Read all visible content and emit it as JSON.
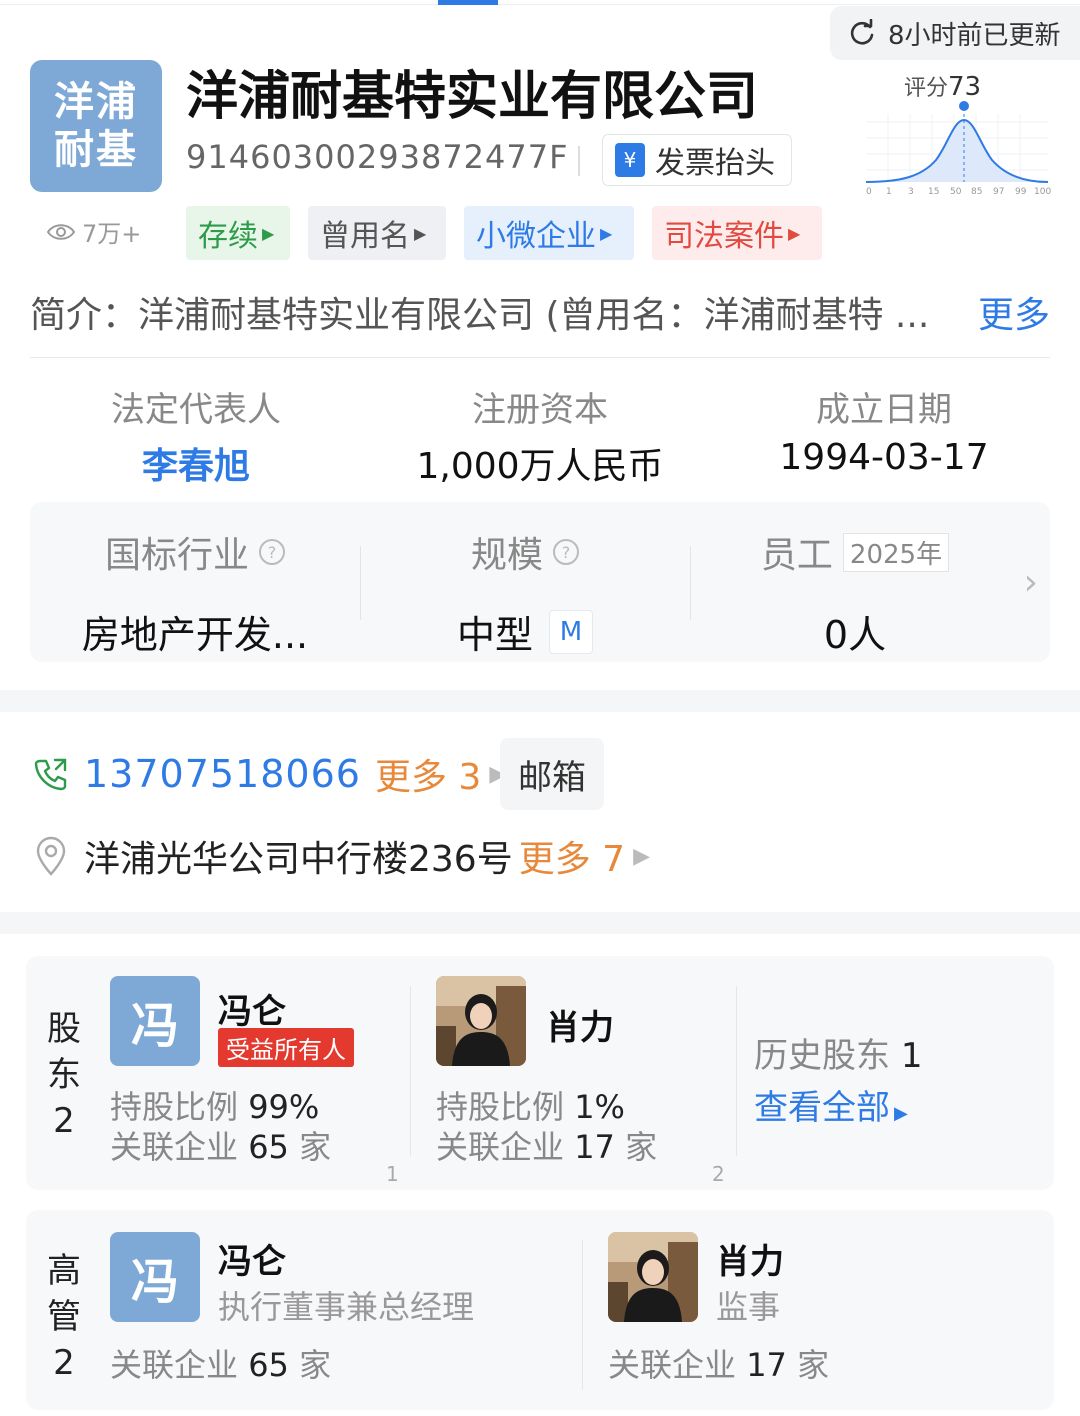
{
  "header": {
    "update_text": "8小时前已更新"
  },
  "company": {
    "logo_line1": "洋浦",
    "logo_line2": "耐基",
    "name": "洋浦耐基特实业有限公司",
    "credit_code": "9146030029387247​7F",
    "invoice_label": "发票抬头",
    "invoice_icon": "¥",
    "views": "7万+",
    "score_label": "评分",
    "score_value": "73",
    "score_ticks": [
      "0",
      "1",
      "3",
      "15",
      "50",
      "85",
      "97",
      "99",
      "100"
    ],
    "tags": [
      {
        "label": "存续"
      },
      {
        "label": "曾用名"
      },
      {
        "label": "小微企业"
      },
      {
        "label": "司法案件"
      }
    ],
    "intro": "简介：洋浦耐基特实业有限公司 (曾用名：洋浦耐基特 ...",
    "intro_more": "更多"
  },
  "basic_info": {
    "legal_rep_label": "法定代表人",
    "legal_rep_value": "李春旭",
    "capital_label": "注册资本",
    "capital_value": "1,000万人民币",
    "founded_label": "成立日期",
    "founded_value": "1994-03-17"
  },
  "industry_card": {
    "industry_label": "国标行业",
    "industry_value": "房地产开发...",
    "scale_label": "规模",
    "scale_value": "中型",
    "scale_chip": "M",
    "staff_label": "员工",
    "staff_year": "2025年",
    "staff_value": "0人"
  },
  "contact": {
    "phone": "13707518066",
    "phone_more": "更多 3",
    "mail_label": "邮箱",
    "address": "洋浦光华公司中行楼236号",
    "address_more": "更多 7"
  },
  "shareholders": {
    "label_chars": [
      "股",
      "东",
      "2"
    ],
    "items": [
      {
        "avatar_letter": "冯",
        "name": "冯仑",
        "badge": "受益所有人",
        "share_label": "持股比例",
        "share_value": "99%",
        "related_label": "关联企业",
        "related_value": "65",
        "related_unit": "家",
        "index": "1"
      },
      {
        "name": "肖力",
        "share_label": "持股比例",
        "share_value": "1%",
        "related_label": "关联企业",
        "related_value": "17",
        "related_unit": "家",
        "index": "2"
      }
    ],
    "history_label": "历史股东",
    "history_count": "1",
    "view_all": "查看全部"
  },
  "executives": {
    "label_chars": [
      "高",
      "管",
      "2"
    ],
    "items": [
      {
        "avatar_letter": "冯",
        "name": "冯仑",
        "role": "执行董事兼总经理",
        "related_label": "关联企业",
        "related_value": "65",
        "related_unit": "家"
      },
      {
        "name": "肖力",
        "role": "监事",
        "related_label": "关联企业",
        "related_value": "17",
        "related_unit": "家"
      }
    ]
  },
  "colors": {
    "accent": "#2f7be5",
    "orange": "#e8883a",
    "red_badge": "#e3392e",
    "logo_bg": "#7ea8d6"
  }
}
